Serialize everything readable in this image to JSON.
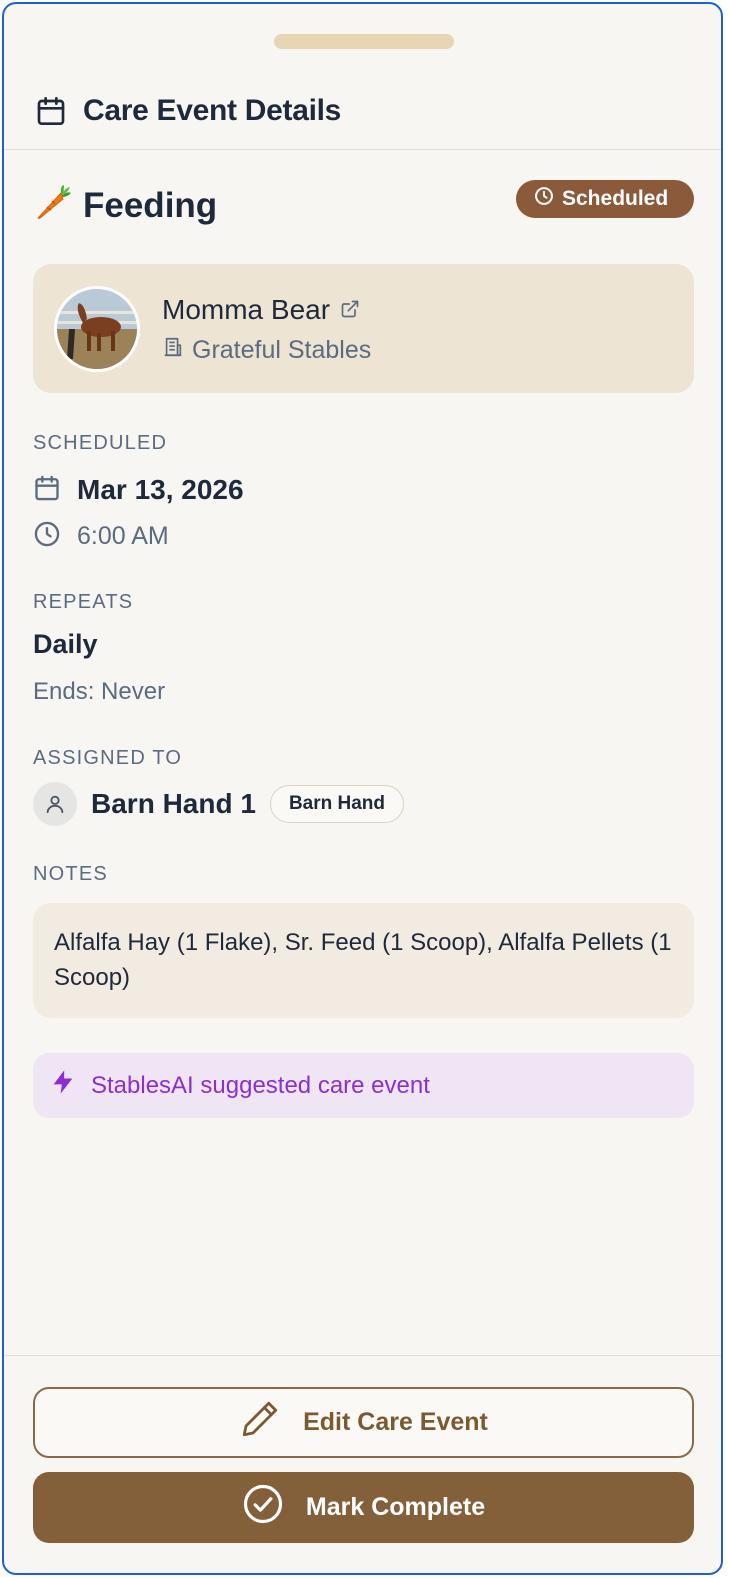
{
  "header": {
    "title": "Care Event Details",
    "icon": "calendar-icon"
  },
  "event": {
    "type_label": "Feeding",
    "type_icon": "carrot",
    "status_label": "Scheduled",
    "status_color": "#8a5a3b"
  },
  "horse": {
    "name": "Momma Bear",
    "stable": "Grateful Stables",
    "link_icon": "external-link-icon",
    "stable_icon": "building-icon"
  },
  "scheduled": {
    "label": "SCHEDULED",
    "date": "Mar 13, 2026",
    "time": "6:00 AM"
  },
  "repeats": {
    "label": "REPEATS",
    "frequency": "Daily",
    "ends": "Ends: Never"
  },
  "assigned": {
    "label": "ASSIGNED TO",
    "name": "Barn Hand 1",
    "role": "Barn Hand"
  },
  "notes": {
    "label": "NOTES",
    "text": "Alfalfa Hay (1 Flake), Sr. Feed (1 Scoop), Alfalfa Pellets (1 Scoop)"
  },
  "ai_note": {
    "text": "StablesAI suggested care event",
    "color": "#8c2fd0"
  },
  "actions": {
    "edit_label": "Edit Care Event",
    "complete_label": "Mark Complete"
  },
  "colors": {
    "accent": "#83603a",
    "background": "#f8f6f2",
    "card": "#ede4d4"
  }
}
